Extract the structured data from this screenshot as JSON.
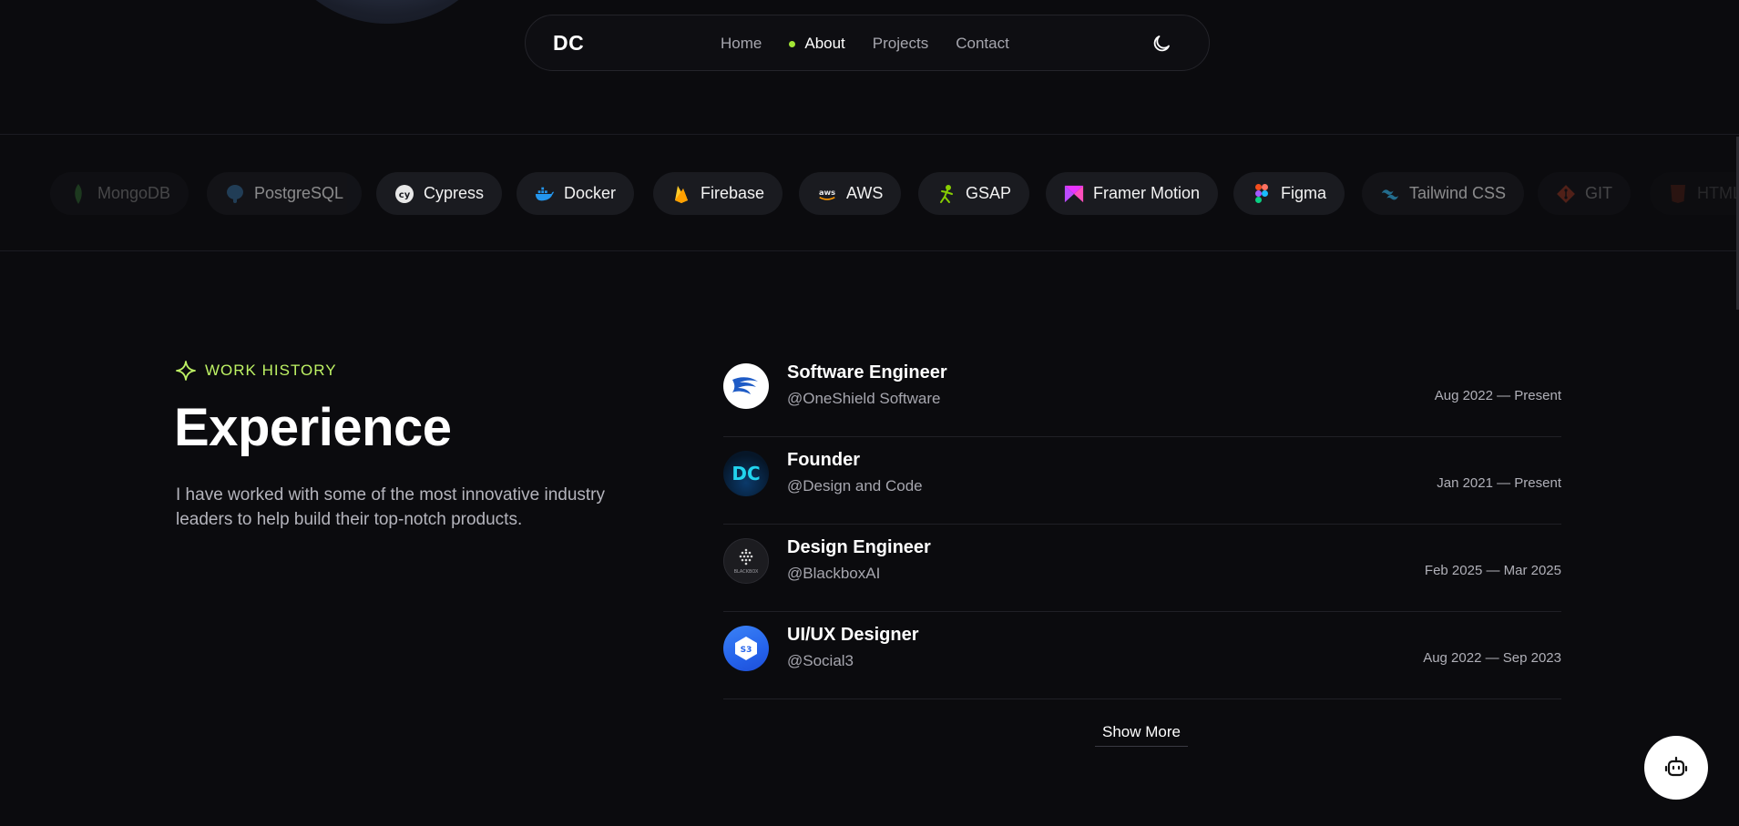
{
  "nav": {
    "logo": "DC",
    "links": [
      {
        "label": "Home",
        "active": false
      },
      {
        "label": "About",
        "active": true
      },
      {
        "label": "Projects",
        "active": false
      },
      {
        "label": "Contact",
        "active": false
      }
    ],
    "theme_icon": "moon-icon",
    "active_dot_color": "#a3e635"
  },
  "tech_strip": {
    "items": [
      {
        "label": "MongoDB",
        "icon": "mongodb-icon"
      },
      {
        "label": "PostgreSQL",
        "icon": "postgresql-icon"
      },
      {
        "label": "Cypress",
        "icon": "cypress-icon"
      },
      {
        "label": "Docker",
        "icon": "docker-icon"
      },
      {
        "label": "Firebase",
        "icon": "firebase-icon"
      },
      {
        "label": "AWS",
        "icon": "aws-icon"
      },
      {
        "label": "GSAP",
        "icon": "gsap-icon"
      },
      {
        "label": "Framer Motion",
        "icon": "framer-motion-icon"
      },
      {
        "label": "Figma",
        "icon": "figma-icon"
      },
      {
        "label": "Tailwind CSS",
        "icon": "tailwind-icon"
      },
      {
        "label": "GIT",
        "icon": "git-icon"
      },
      {
        "label": "HTML",
        "icon": "html-icon"
      }
    ]
  },
  "work_history": {
    "eyebrow": "WORK HISTORY",
    "eyebrow_icon": "sparkle-icon",
    "accent_color": "#bef264",
    "heading": "Experience",
    "description": "I have worked with some of the most innovative industry leaders to help build their top-notch products."
  },
  "experience": [
    {
      "title": "Software Engineer",
      "company": "@OneShield Software",
      "dates": "Aug 2022 — Present",
      "logo": "oneshield-logo"
    },
    {
      "title": "Founder",
      "company": "@Design and Code",
      "dates": "Jan 2021 — Present",
      "logo": "design-and-code-logo",
      "logo_text": "DC"
    },
    {
      "title": "Design Engineer",
      "company": "@BlackboxAI",
      "dates": "Feb 2025 — Mar 2025",
      "logo": "blackbox-logo",
      "logo_text": "BLACKBOX"
    },
    {
      "title": "UI/UX Designer",
      "company": "@Social3",
      "dates": "Aug 2022 — Sep 2023",
      "logo": "social3-logo",
      "logo_text": "S3"
    }
  ],
  "show_more_label": "Show More",
  "chatbot_icon": "robot-icon"
}
